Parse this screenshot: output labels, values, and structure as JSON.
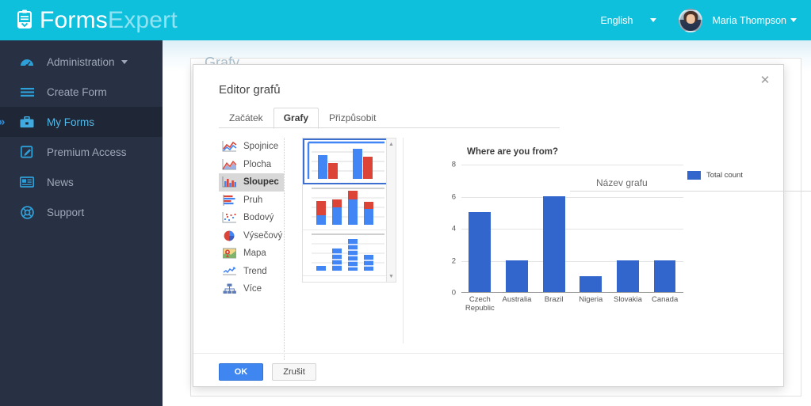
{
  "header": {
    "brand_primary": "Forms",
    "brand_secondary": "Expert",
    "brand_icon": "clipboard-icon",
    "language": "English",
    "username": "Maria Thompson",
    "bg_color": "#0fc0dd"
  },
  "sidebar": {
    "bg_color": "#283043",
    "active_color": "#53b9e8",
    "items": [
      {
        "label": "Administration",
        "icon": "dashboard-gauge-icon",
        "has_caret": true,
        "active": false
      },
      {
        "label": "Create Form",
        "icon": "hamburger-list-icon",
        "has_caret": false,
        "active": false
      },
      {
        "label": "My Forms",
        "icon": "briefcase-icon",
        "has_caret": false,
        "active": true
      },
      {
        "label": "Premium Access",
        "icon": "edit-pencil-icon",
        "has_caret": false,
        "active": false
      },
      {
        "label": "News",
        "icon": "newspaper-icon",
        "has_caret": false,
        "active": false
      },
      {
        "label": "Support",
        "icon": "lifebuoy-icon",
        "has_caret": false,
        "active": false
      }
    ]
  },
  "background_page": {
    "title": "Grafy"
  },
  "modal": {
    "title": "Editor grafů",
    "close_icon": "close-icon",
    "tabs": [
      {
        "label": "Začátek",
        "active": false
      },
      {
        "label": "Grafy",
        "active": true
      },
      {
        "label": "Přizpůsobit",
        "active": false
      }
    ],
    "chart_name_label": "Název grafu",
    "chart_types": [
      {
        "label": "Spojnice",
        "icon": "line-chart-icon",
        "selected": false
      },
      {
        "label": "Plocha",
        "icon": "area-chart-icon",
        "selected": false
      },
      {
        "label": "Sloupec",
        "icon": "column-chart-icon",
        "selected": true
      },
      {
        "label": "Pruh",
        "icon": "bar-chart-icon",
        "selected": false
      },
      {
        "label": "Bodový",
        "icon": "scatter-chart-icon",
        "selected": false
      },
      {
        "label": "Výsečový",
        "icon": "pie-chart-icon",
        "selected": false
      },
      {
        "label": "Mapa",
        "icon": "map-chart-icon",
        "selected": false
      },
      {
        "label": "Trend",
        "icon": "trend-chart-icon",
        "selected": false
      },
      {
        "label": "Více",
        "icon": "org-chart-more-icon",
        "selected": false
      }
    ],
    "thumbnails": [
      {
        "name": "grouped-column-thumbnail",
        "selected": true
      },
      {
        "name": "stacked-column-thumbnail",
        "selected": false
      },
      {
        "name": "percent-stacked-column-thumbnail",
        "selected": false
      }
    ],
    "buttons": {
      "ok": "OK",
      "cancel": "Zrušit"
    }
  },
  "chart_data": {
    "type": "bar",
    "title": "Where are you from?",
    "categories": [
      "Czech Republic",
      "Australia",
      "Brazil",
      "Nigeria",
      "Slovakia",
      "Canada"
    ],
    "values": [
      5,
      2,
      6,
      1,
      2,
      2
    ],
    "series": [
      {
        "name": "Total count",
        "values": [
          5,
          2,
          6,
          1,
          2,
          2
        ],
        "color": "#3366cc"
      }
    ],
    "yticks": [
      0,
      2,
      4,
      6,
      8
    ],
    "ylim": [
      0,
      8
    ],
    "xlabel": "",
    "ylabel": "",
    "legend": [
      "Total count"
    ],
    "legend_position": "right",
    "grid": true
  }
}
